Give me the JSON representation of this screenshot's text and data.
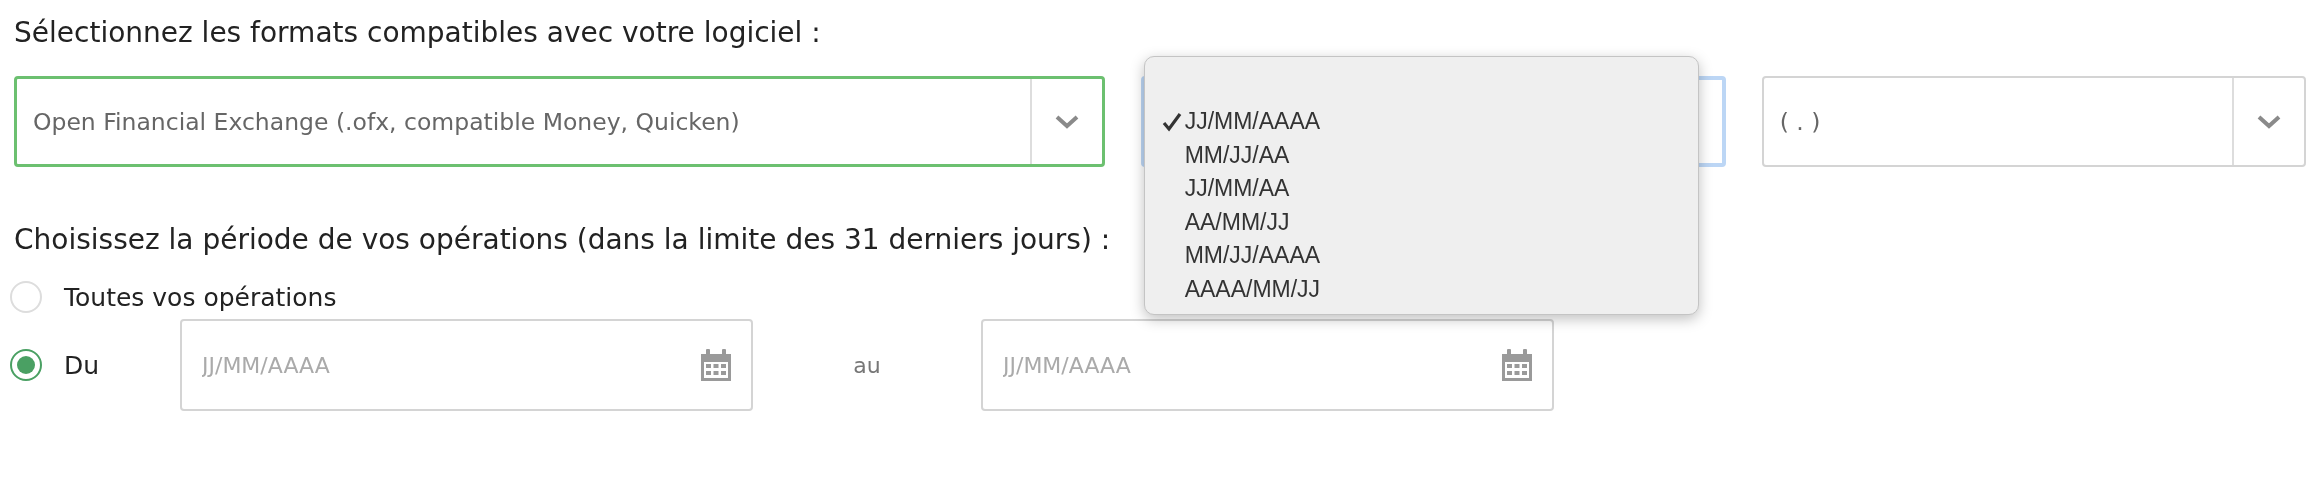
{
  "format_heading": "Sélectionnez les formats compatibles avec votre logiciel :",
  "format_select": {
    "value": "Open Financial Exchange (.ofx, compatible Money, Quicken)"
  },
  "date_format_select": {
    "expanded": true,
    "options": [
      {
        "label": "JJ/MM/AAAA",
        "selected": true
      },
      {
        "label": "MM/JJ/AA",
        "selected": false
      },
      {
        "label": "JJ/MM/AA",
        "selected": false
      },
      {
        "label": "AA/MM/JJ",
        "selected": false
      },
      {
        "label": "MM/JJ/AAAA",
        "selected": false
      },
      {
        "label": "AAAA/MM/JJ",
        "selected": false
      }
    ]
  },
  "separator_select": {
    "value": "( . )"
  },
  "period_heading": "Choisissez la période de vos opérations (dans la limite des 31 derniers jours) :",
  "period_options": [
    {
      "label": "Toutes vos opérations",
      "selected": false
    },
    {
      "label": "Du",
      "selected": true
    }
  ],
  "date_from": {
    "placeholder": "JJ/MM/AAAA"
  },
  "range_separator": "au",
  "date_to": {
    "placeholder": "JJ/MM/AAAA"
  }
}
